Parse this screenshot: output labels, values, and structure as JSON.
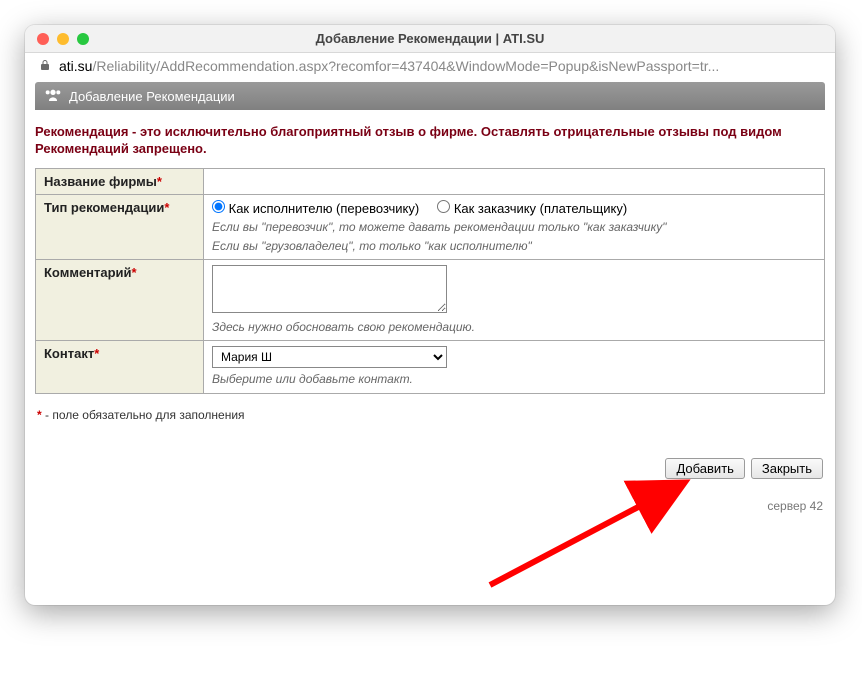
{
  "window": {
    "title": "Добавление Рекомендации | ATI.SU",
    "url_host": "ati.su",
    "url_path": "/Reliability/AddRecommendation.aspx?recomfor=437404&WindowMode=Popup&isNewPassport=tr..."
  },
  "banner": {
    "title": "Добавление Рекомендации"
  },
  "warning": "Рекомендация - это исключительно благоприятный отзыв о фирме. Оставлять отрицательные отзывы под видом Рекомендаций запрещено.",
  "form": {
    "company_label": "Название фирмы",
    "type_label": "Тип рекомендации",
    "type_option_executor": "Как исполнителю (перевозчику)",
    "type_option_customer": "Как заказчику (плательщику)",
    "type_selected": "executor",
    "type_hint1": "Если вы \"перевозчик\", то можете давать рекомендации только \"как заказчику\"",
    "type_hint2": "Если вы \"грузовладелец\", то только \"как исполнителю\"",
    "comment_label": "Комментарий",
    "comment_value": "",
    "comment_hint": "Здесь нужно обосновать свою рекомендацию.",
    "contact_label": "Контакт",
    "contact_value": "Мария Ш",
    "contact_hint": "Выберите или добавьте контакт."
  },
  "footnote": "- поле обязательно для заполнения",
  "buttons": {
    "add": "Добавить",
    "close": "Закрыть"
  },
  "server_text": "сервер 42"
}
